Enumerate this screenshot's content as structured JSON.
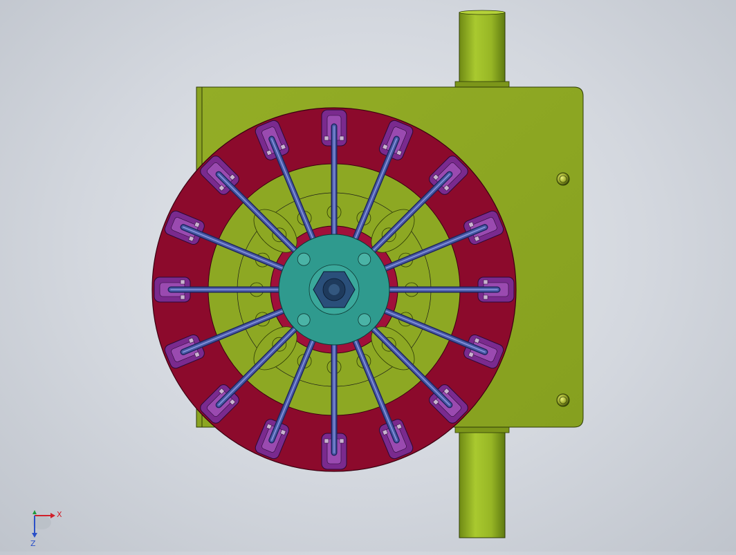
{
  "viewport": {
    "view_name": "cad-graphics-area",
    "colors": {
      "plate": "#8da823",
      "plate_dark": "#5f7412",
      "tube": "#98b826",
      "disk": "#8c0a2c",
      "ring": "#a0103a",
      "hub": "#2f9a8e",
      "nut": "#2a4f7a",
      "clamp": "#7a2a8e",
      "spoke": "#4a5aa8"
    },
    "assembly": {
      "spoke_count": 16
    }
  },
  "triad": {
    "x_label": "X",
    "z_label": "Z"
  }
}
